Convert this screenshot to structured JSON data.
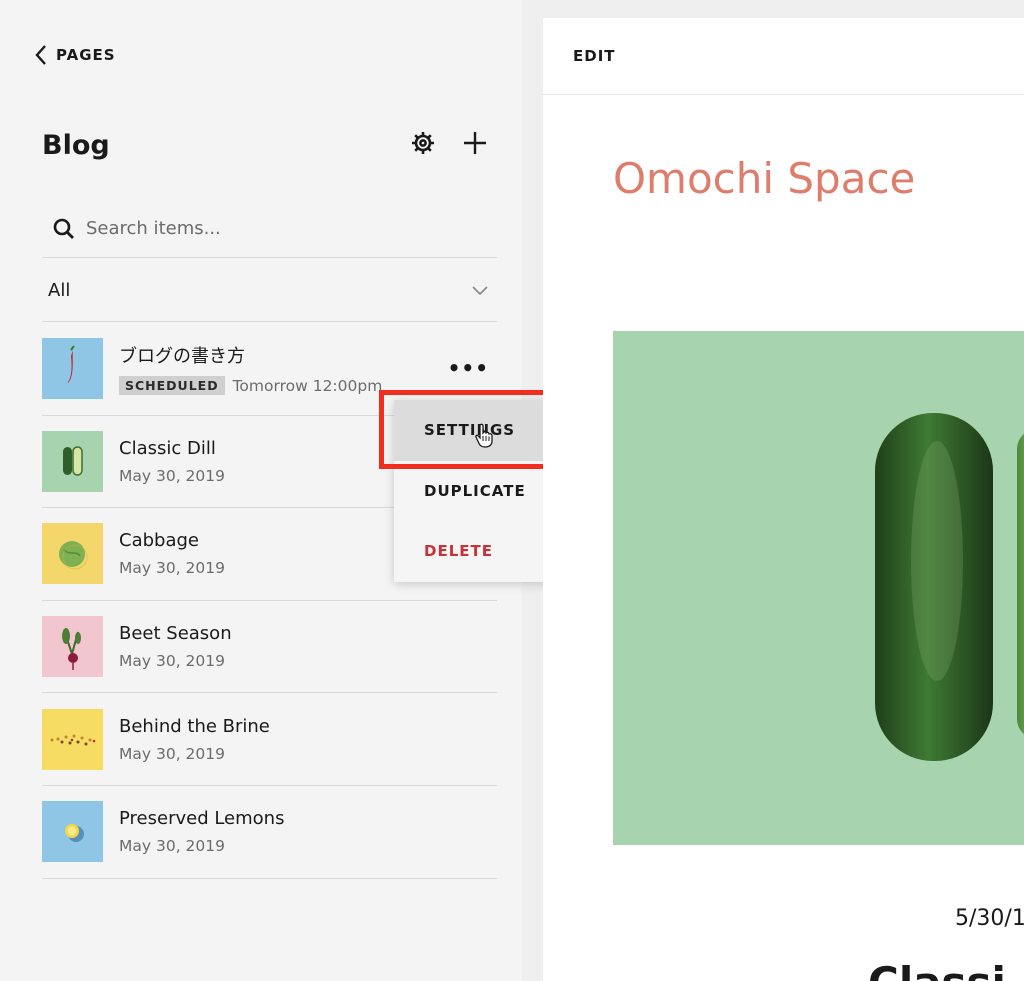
{
  "sidebar": {
    "back_label": "PAGES",
    "title": "Blog",
    "search_placeholder": "Search items...",
    "filter_value": "All",
    "items": [
      {
        "title": "ブログの書き方",
        "badge": "SCHEDULED",
        "meta": "Tomorrow 12:00pm",
        "thumb": "chili-pepper"
      },
      {
        "title": "Classic Dill",
        "meta": "May 30, 2019",
        "thumb": "pickle-slices"
      },
      {
        "title": "Cabbage",
        "meta": "May 30, 2019",
        "thumb": "cabbage"
      },
      {
        "title": "Beet Season",
        "meta": "May 30, 2019",
        "thumb": "beet"
      },
      {
        "title": "Behind the Brine",
        "meta": "May 30, 2019",
        "thumb": "spices"
      },
      {
        "title": "Preserved Lemons",
        "meta": "May 30, 2019",
        "thumb": "lemon"
      }
    ],
    "more_label": "•••"
  },
  "context_menu": {
    "items": [
      {
        "label": "SETTINGS",
        "state": "hover"
      },
      {
        "label": "DUPLICATE"
      },
      {
        "label": "DELETE",
        "color": "#c53237"
      }
    ]
  },
  "preview": {
    "edit_label": "EDIT",
    "site_title": "Omochi Space",
    "date": "5/30/1",
    "post_title": "Classi"
  },
  "colors": {
    "accent": "#df7d6c",
    "highlight": "#f02d1f",
    "danger": "#c53237",
    "hero_bg": "#a7d3af"
  }
}
